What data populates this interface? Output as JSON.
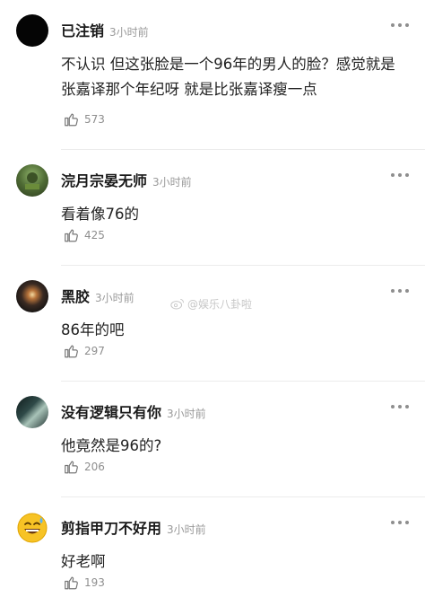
{
  "comments": [
    {
      "username": "已注销",
      "time": "3小时前",
      "text": "不认识 但这张脸是一个96年的男人的脸？感觉就是张嘉译那个年纪呀 就是比张嘉译瘦一点",
      "likes": "573",
      "avatar_icon": "blank-avatar-icon"
    },
    {
      "username": "浣月宗晏无师",
      "time": "3小时前",
      "text": "看着像76的",
      "likes": "425",
      "avatar_icon": "green-photo-avatar-icon"
    },
    {
      "username": "黑胶",
      "time": "3小时前",
      "text": "86年的吧",
      "likes": "297",
      "avatar_icon": "dark-glow-avatar-icon"
    },
    {
      "username": "没有逻辑只有你",
      "time": "3小时前",
      "text": "他竟然是96的?",
      "likes": "206",
      "avatar_icon": "teal-portrait-avatar-icon"
    },
    {
      "username": "剪指甲刀不好用",
      "time": "3小时前",
      "text": "好老啊",
      "likes": "193",
      "avatar_icon": "sweat-smile-emoji-avatar-icon"
    }
  ],
  "watermark": "@娱乐八卦啦",
  "colors": {
    "username": "#1a1a1a",
    "meta": "#9a9a9a",
    "divider": "#ececec"
  }
}
